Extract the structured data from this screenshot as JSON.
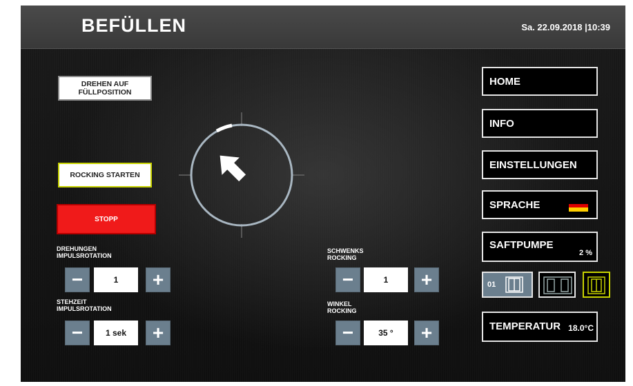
{
  "header": {
    "title": "BEFÜLLEN",
    "datetime": "Sa. 22.09.2018 |10:39"
  },
  "left": {
    "drehen_btn": "DREHEN AUF FÜLLPOSITION",
    "rocking_btn": "ROCKING STARTEN",
    "stopp_btn": "STOPP"
  },
  "controls": {
    "drehungen": {
      "label1": "DREHUNGEN",
      "label2": "IMPULSROTATION",
      "value": "1"
    },
    "stehzeit": {
      "label1": "STEHZEIT",
      "label2": "IMPULSROTATION",
      "value": "1 sek"
    },
    "schwenks": {
      "label1": "SCHWENKS",
      "label2": "ROCKING",
      "value": "1"
    },
    "winkel": {
      "label1": "WINKEL",
      "label2": "ROCKING",
      "value": "35 °"
    },
    "minus": "−",
    "plus": "+"
  },
  "menu": {
    "home": "HOME",
    "info": "INFO",
    "einstellungen": "EINSTELLUNGEN",
    "sprache": "SPRACHE",
    "saftpumpe": "SAFTPUMPE",
    "saftpumpe_value": "2 %",
    "temperatur": "TEMPERATUR",
    "temperatur_value": "18.0°C"
  },
  "modes": {
    "mode1_label": "01"
  },
  "colors": {
    "stop_red": "#f01a1a",
    "stepper_blue": "#6b7f8e",
    "active_yellow": "#c8d400",
    "gauge_ring": "#a9b7c2"
  },
  "icons": {
    "direction": "arrow-up-left-icon",
    "language": "german-flag-icon"
  }
}
